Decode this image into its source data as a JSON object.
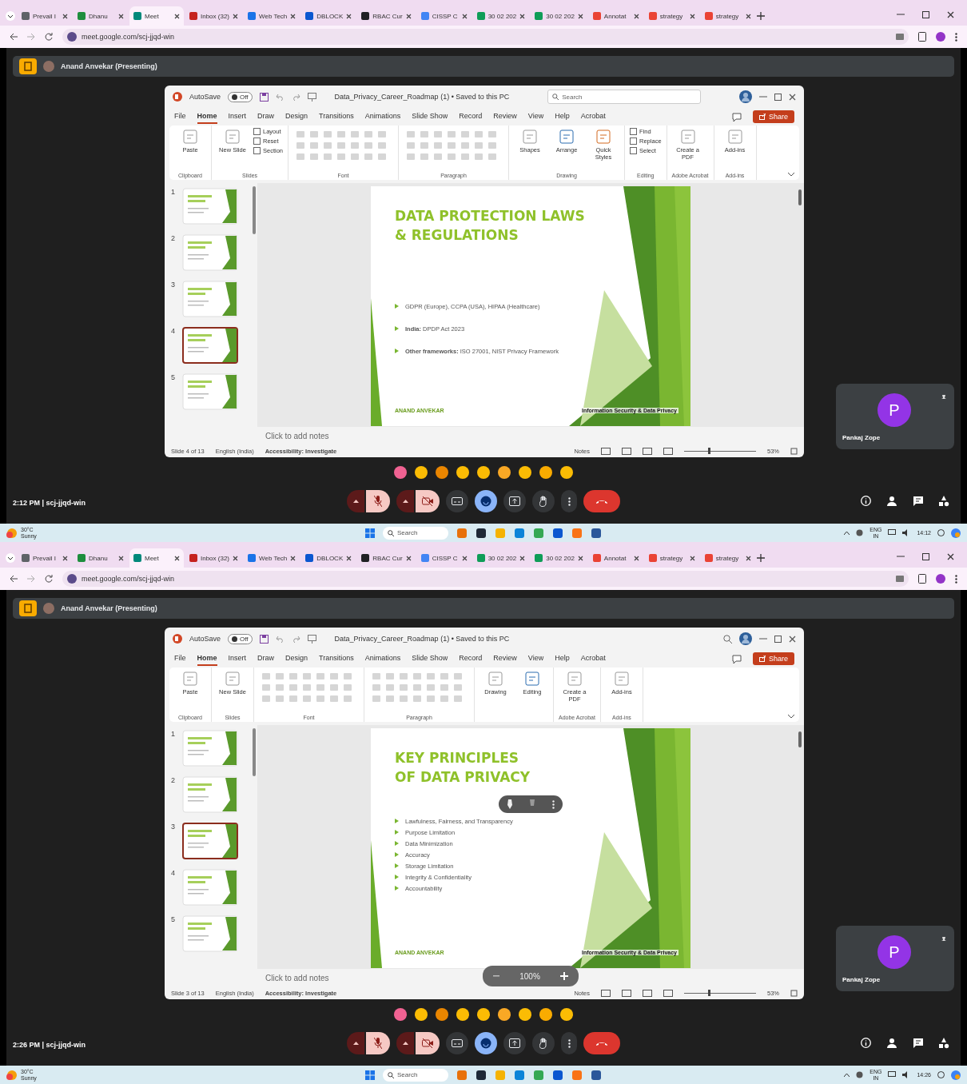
{
  "screens": [
    {
      "browser": {
        "tabs": [
          {
            "title": "Prevail I",
            "color": "#5f6368",
            "selected": false
          },
          {
            "title": "Dhanu",
            "color": "#1e8e3e",
            "selected": false
          },
          {
            "title": "Meet",
            "color": "#00897b",
            "selected": true
          },
          {
            "title": "Inbox (32)",
            "color": "#c5221f",
            "selected": false
          },
          {
            "title": "Web Tech",
            "color": "#1a73e8",
            "selected": false
          },
          {
            "title": "DBLOCK",
            "color": "#0b57d0",
            "selected": false
          },
          {
            "title": "RBAC Cur",
            "color": "#202124",
            "selected": false
          },
          {
            "title": "CISSP C",
            "color": "#4285f4",
            "selected": false
          },
          {
            "title": "30 02 202",
            "color": "#0f9d58",
            "selected": false
          },
          {
            "title": "30 02 202",
            "color": "#0f9d58",
            "selected": false
          },
          {
            "title": "Annotat",
            "color": "#ea4335",
            "selected": false
          },
          {
            "title": "strategy",
            "color": "#ea4335",
            "selected": false
          },
          {
            "title": "strategy",
            "color": "#ea4335",
            "selected": false
          }
        ],
        "address": "meet.google.com/scj-jjqd-win"
      },
      "presenter": "Anand Anvekar (Presenting)",
      "powerpoint": {
        "autosave": "AutoSave",
        "autosave_state": "Off",
        "autosave_on": false,
        "title": "Data_Privacy_Career_Roadmap (1) • Saved to this PC",
        "search": "Search",
        "menu": [
          {
            "label": "File",
            "selected": false
          },
          {
            "label": "Home",
            "selected": true
          },
          {
            "label": "Insert",
            "selected": false
          },
          {
            "label": "Draw",
            "selected": false
          },
          {
            "label": "Design",
            "selected": false
          },
          {
            "label": "Transitions",
            "selected": false
          },
          {
            "label": "Animations",
            "selected": false
          },
          {
            "label": "Slide Show",
            "selected": false
          },
          {
            "label": "Record",
            "selected": false
          },
          {
            "label": "Review",
            "selected": false
          },
          {
            "label": "View",
            "selected": false
          },
          {
            "label": "Help",
            "selected": false
          },
          {
            "label": "Acrobat",
            "selected": false
          }
        ],
        "share": "Share",
        "groups": [
          {
            "kind": "buttons",
            "label": "Clipboard",
            "buttons": [
              "Paste"
            ]
          },
          {
            "kind": "buttons",
            "label": "Slides",
            "buttons": [
              "New Slide"
            ],
            "small": [
              "Layout",
              "Reset",
              "Section"
            ]
          },
          {
            "kind": "formatting",
            "label": "Font"
          },
          {
            "kind": "formatting",
            "label": "Paragraph"
          },
          {
            "kind": "buttons",
            "label": "Drawing",
            "buttons": [
              "Shapes",
              "Arrange",
              "Quick Styles"
            ]
          },
          {
            "kind": "buttons",
            "label": "Editing",
            "small": [
              "Find",
              "Replace",
              "Select"
            ]
          },
          {
            "kind": "buttons",
            "label": "Adobe Acrobat",
            "buttons": [
              "Create a PDF"
            ]
          },
          {
            "kind": "buttons",
            "label": "Add-ins",
            "buttons": [
              "Add-ins"
            ]
          }
        ],
        "thumbnails": [
          {
            "number": "1",
            "selected": false
          },
          {
            "number": "2",
            "selected": false
          },
          {
            "number": "3",
            "selected": false
          },
          {
            "number": "4",
            "selected": true
          },
          {
            "number": "5",
            "selected": false
          }
        ],
        "slide": {
          "title_lines": [
            "DATA PROTECTION LAWS",
            "& REGULATIONS"
          ],
          "bullets": [
            "GDPR (Europe), CCPA (USA), HIPAA (Healthcare)",
            "**India:** DPDP Act 2023",
            "**Other frameworks:** ISO 27001, NIST Privacy Framework"
          ],
          "author": "ANAND ANVEKAR",
          "footer": "Information Security & Data Privacy"
        },
        "notes": "Click to add notes",
        "status": {
          "slide": "Slide 4 of 13",
          "language": "English (India)",
          "accessibility": "Accessibility: Investigate",
          "notes": "Notes",
          "zoom": "53%",
          "zoom_slider": {
            "level": 0.35
          }
        }
      },
      "participant": {
        "initial": "P",
        "name": "Pankaj Zope"
      },
      "meeting": {
        "info": "2:12 PM | scj-jjqd-win"
      },
      "controls": [
        {
          "kind": "mic",
          "off": true
        },
        {
          "kind": "camera",
          "off": true
        },
        {
          "kind": "captions",
          "on": false
        },
        {
          "kind": "reactions",
          "on": true
        },
        {
          "kind": "present",
          "on": false
        },
        {
          "kind": "hand",
          "on": false
        },
        {
          "kind": "more",
          "on": false
        },
        {
          "kind": "leave"
        }
      ],
      "taskbar": {
        "temperature": "30°C",
        "weather": "Sunny",
        "search": "Search",
        "language": "ENG",
        "region": "IN",
        "time": "14:12"
      }
    },
    {
      "browser": {
        "tabs": [
          {
            "title": "Prevail I",
            "color": "#5f6368",
            "selected": false
          },
          {
            "title": "Dhanu",
            "color": "#1e8e3e",
            "selected": false
          },
          {
            "title": "Meet",
            "color": "#00897b",
            "selected": true
          },
          {
            "title": "Inbox (32)",
            "color": "#c5221f",
            "selected": false
          },
          {
            "title": "Web Tech",
            "color": "#1a73e8",
            "selected": false
          },
          {
            "title": "DBLOCK",
            "color": "#0b57d0",
            "selected": false
          },
          {
            "title": "RBAC Cur",
            "color": "#202124",
            "selected": false
          },
          {
            "title": "CISSP C",
            "color": "#4285f4",
            "selected": false
          },
          {
            "title": "30 02 202",
            "color": "#0f9d58",
            "selected": false
          },
          {
            "title": "30 02 202",
            "color": "#0f9d58",
            "selected": false
          },
          {
            "title": "Annotat",
            "color": "#ea4335",
            "selected": false
          },
          {
            "title": "strategy",
            "color": "#ea4335",
            "selected": false
          },
          {
            "title": "strategy",
            "color": "#ea4335",
            "selected": false
          }
        ],
        "address": "meet.google.com/scj-jjqd-win"
      },
      "presenter": "Anand Anvekar (Presenting)",
      "powerpoint": {
        "autosave": "AutoSave",
        "autosave_state": "Off",
        "autosave_on": false,
        "title": "Data_Privacy_Career_Roadmap (1) • Saved to this PC",
        "menu": [
          {
            "label": "File",
            "selected": false
          },
          {
            "label": "Home",
            "selected": true
          },
          {
            "label": "Insert",
            "selected": false
          },
          {
            "label": "Draw",
            "selected": false
          },
          {
            "label": "Design",
            "selected": false
          },
          {
            "label": "Transitions",
            "selected": false
          },
          {
            "label": "Animations",
            "selected": false
          },
          {
            "label": "Slide Show",
            "selected": false
          },
          {
            "label": "Record",
            "selected": false
          },
          {
            "label": "Review",
            "selected": false
          },
          {
            "label": "View",
            "selected": false
          },
          {
            "label": "Help",
            "selected": false
          },
          {
            "label": "Acrobat",
            "selected": false
          }
        ],
        "share": "Share",
        "groups": [
          {
            "kind": "buttons",
            "label": "Clipboard",
            "buttons": [
              "Paste"
            ]
          },
          {
            "kind": "buttons",
            "label": "Slides",
            "buttons": [
              "New Slide"
            ]
          },
          {
            "kind": "formatting",
            "label": "Font"
          },
          {
            "kind": "formatting",
            "label": "Paragraph"
          },
          {
            "kind": "buttons",
            "buttons": [
              "Drawing",
              "Editing"
            ]
          },
          {
            "kind": "buttons",
            "label": "Adobe Acrobat",
            "buttons": [
              "Create a PDF"
            ]
          },
          {
            "kind": "buttons",
            "label": "Add-ins",
            "buttons": [
              "Add-ins"
            ]
          }
        ],
        "thumbnails": [
          {
            "number": "1",
            "selected": false
          },
          {
            "number": "2",
            "selected": false
          },
          {
            "number": "3",
            "selected": true
          },
          {
            "number": "4",
            "selected": false
          },
          {
            "number": "5",
            "selected": false
          }
        ],
        "slide": {
          "title_lines": [
            "KEY PRINCIPLES",
            "OF DATA PRIVACY"
          ],
          "bullets": [
            "Lawfulness, Fairness, and Transparency",
            "Purpose Limitation",
            "Data Minimization",
            "Accuracy",
            "Storage Limitation",
            "Integrity & Confidentiality",
            "Accountability"
          ],
          "author": "ANAND ANVEKAR",
          "footer": "Information Security & Data Privacy"
        },
        "floating_toolbar": true,
        "notes": "Click to add notes",
        "overlay_zoom": "100%",
        "status": {
          "slide": "Slide 3 of 13",
          "language": "English (India)",
          "accessibility": "Accessibility: Investigate",
          "notes": "Notes",
          "zoom": "53%",
          "zoom_slider": {
            "level": 0.35
          }
        }
      },
      "participant": {
        "initial": "P",
        "name": "Pankaj Zope"
      },
      "meeting": {
        "info": "2:26 PM | scj-jjqd-win"
      },
      "controls": [
        {
          "kind": "mic",
          "off": true
        },
        {
          "kind": "camera",
          "off": true
        },
        {
          "kind": "captions",
          "on": false
        },
        {
          "kind": "reactions",
          "on": true
        },
        {
          "kind": "present",
          "on": false
        },
        {
          "kind": "hand",
          "on": false
        },
        {
          "kind": "more",
          "on": false
        },
        {
          "kind": "leave"
        }
      ],
      "taskbar": {
        "temperature": "30°C",
        "weather": "Sunny",
        "search": "Search",
        "language": "ENG",
        "region": "IN",
        "time": "14:26"
      }
    }
  ]
}
